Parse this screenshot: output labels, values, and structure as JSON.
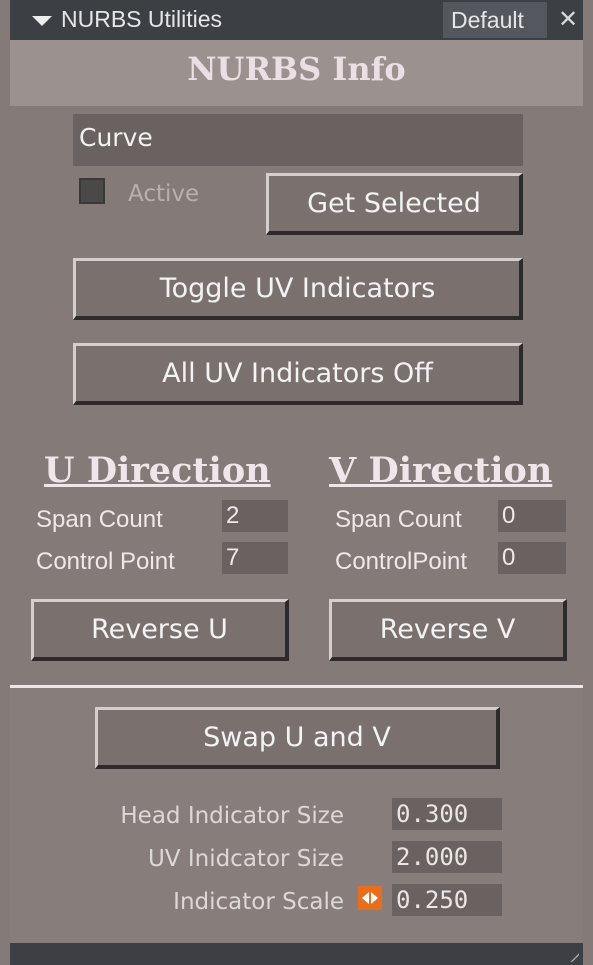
{
  "titlebar": {
    "title": "NURBS Utilities",
    "preset": "Default"
  },
  "header": {
    "title": "NURBS Info"
  },
  "curve_field": {
    "value": "Curve"
  },
  "active": {
    "label": "Active",
    "checked": false
  },
  "buttons": {
    "get_selected": "Get Selected",
    "toggle_uv": "Toggle UV Indicators",
    "all_uv_off": "All UV Indicators Off",
    "reverse_u": "Reverse U",
    "reverse_v": "Reverse V",
    "swap_uv": "Swap U and V"
  },
  "u_direction": {
    "heading": "U Direction",
    "span_label": "Span Count",
    "span_value": "2",
    "cp_label": "Control Point",
    "cp_value": "7"
  },
  "v_direction": {
    "heading": "V Direction",
    "span_label": "Span Count",
    "span_value": "0",
    "cp_label": "ControlPoint",
    "cp_value": "0"
  },
  "settings": {
    "head_size_label": "Head Indicator Size",
    "head_size_value": "0.300",
    "uv_size_label": "UV Inidcator Size",
    "uv_size_value": "2.000",
    "scale_label": "Indicator Scale",
    "scale_value": "0.250"
  },
  "colors": {
    "accent": "#e86e1c",
    "panel": "#847b78",
    "titlebar": "#3c3f44"
  }
}
